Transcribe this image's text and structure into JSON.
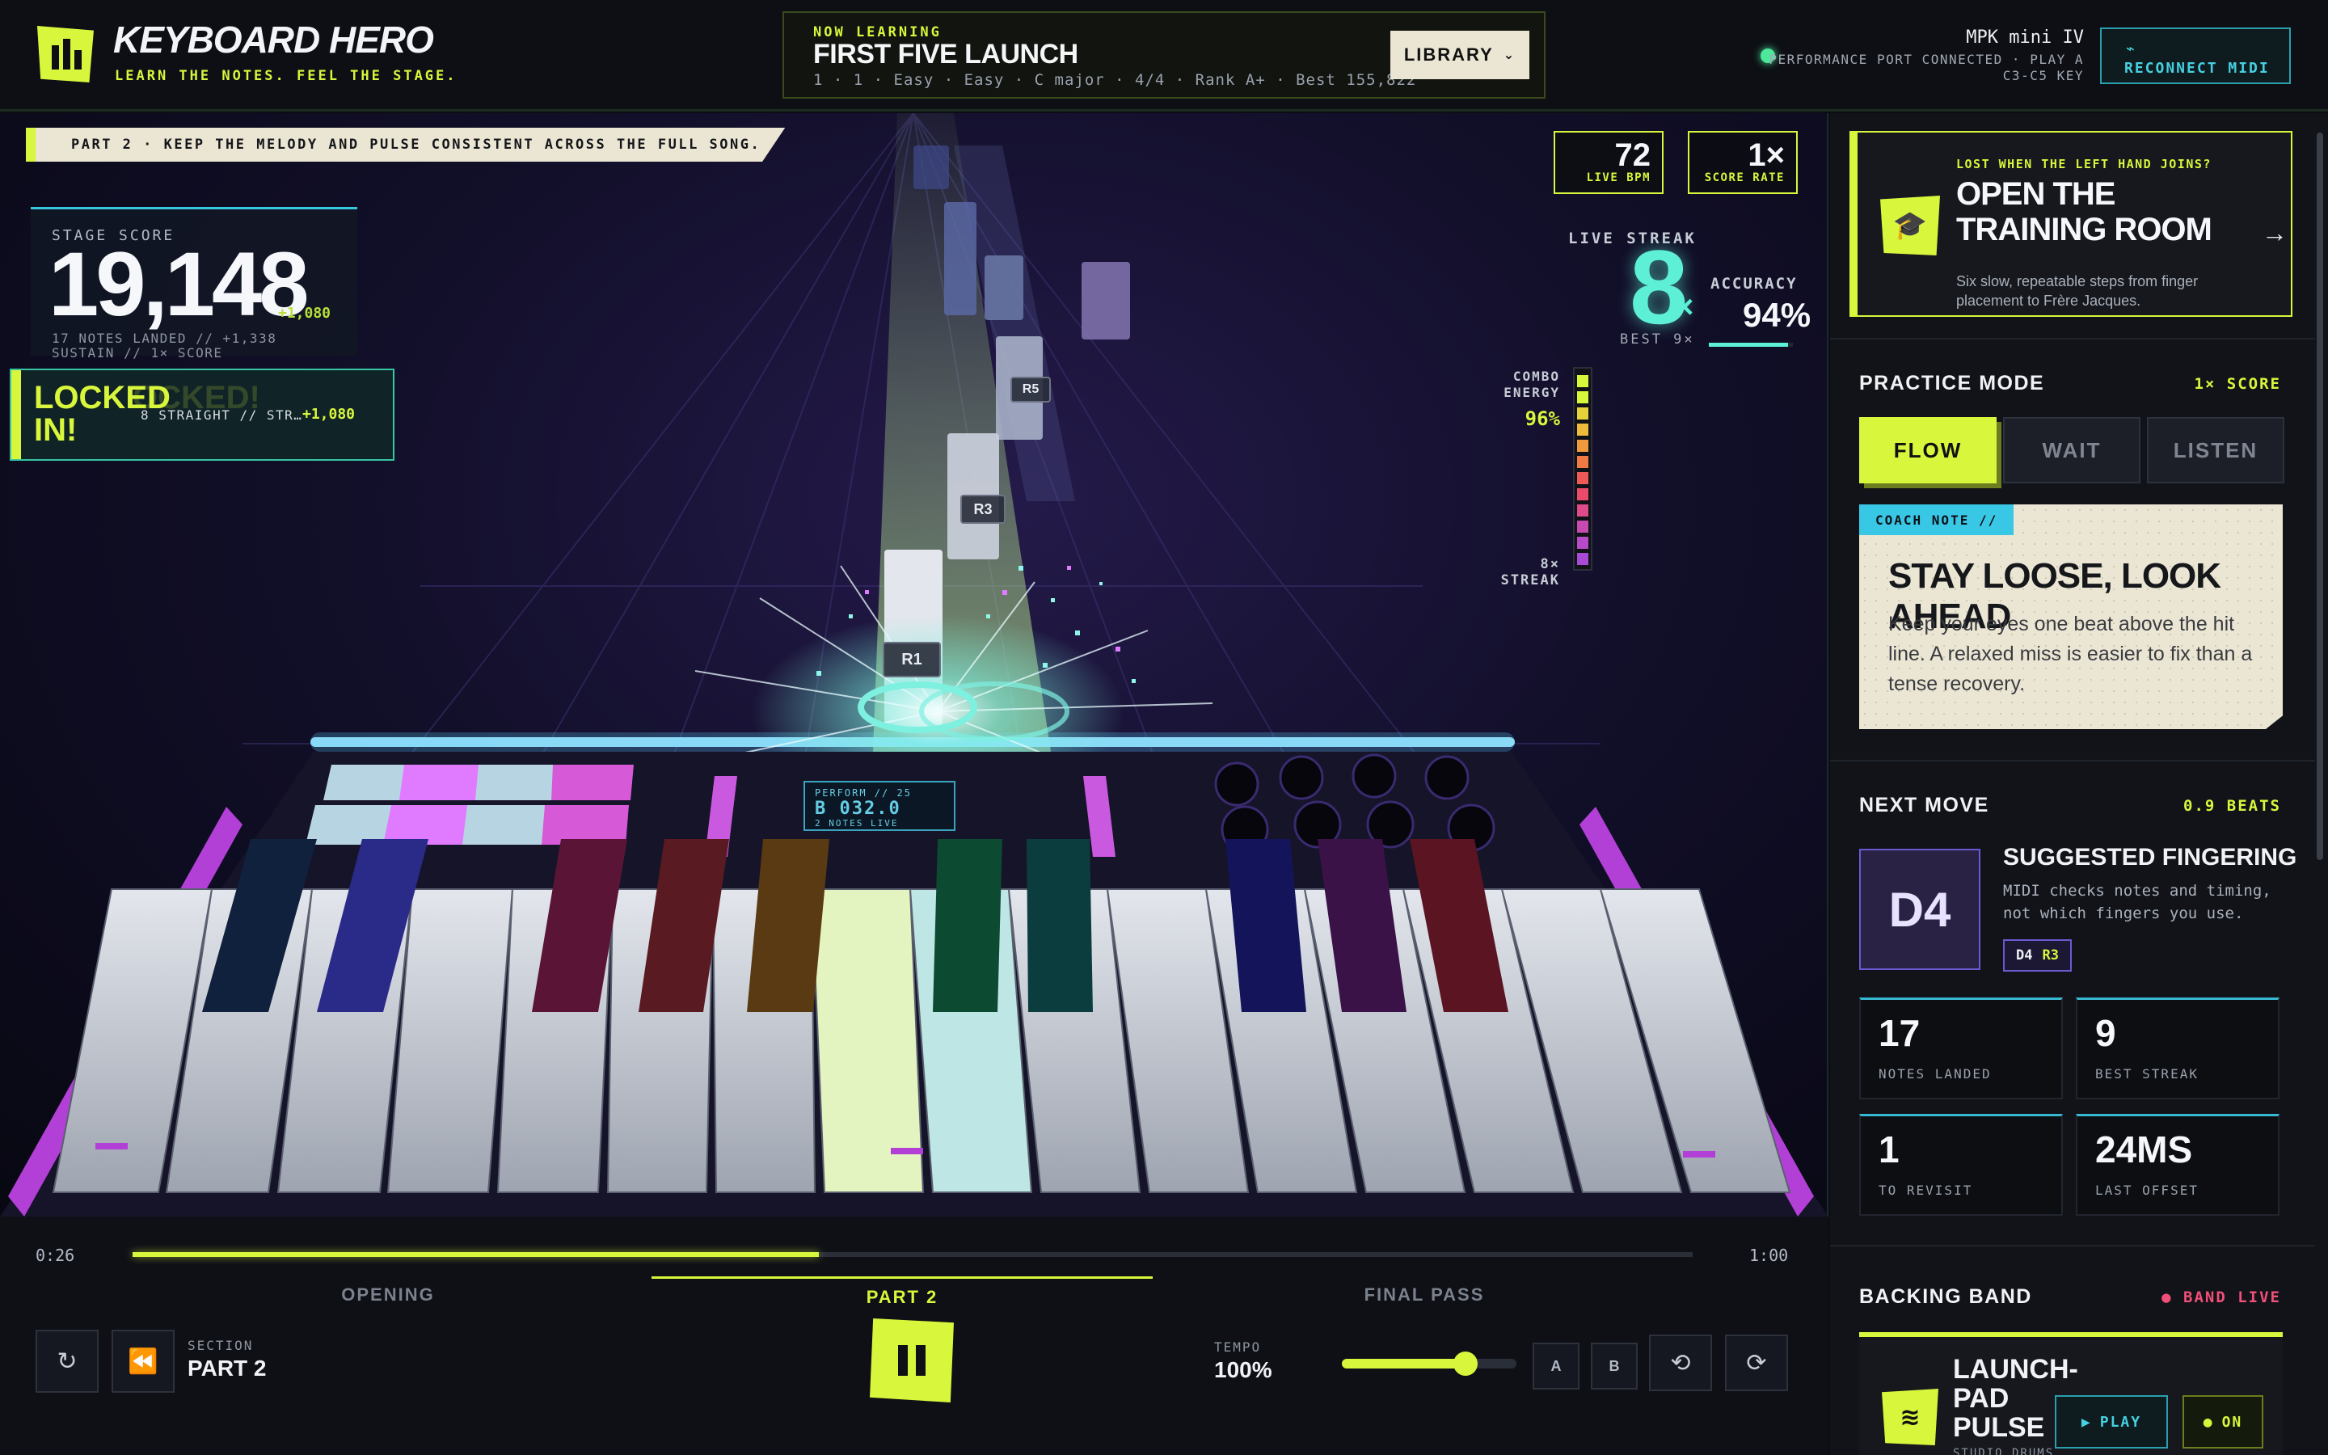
{
  "header": {
    "title": "KEYBOARD HERO",
    "tagline": "LEARN THE NOTES. FEEL THE STAGE.",
    "now_label": "NOW LEARNING",
    "now_title": "FIRST FIVE LAUNCH",
    "now_meta": "1 · 1 · Easy · Easy · C major · 4/4 · Rank A+ · Best 155,822",
    "library_label": "LIBRARY",
    "midi_name": "MPK mini IV",
    "midi_status": "PERFORMANCE PORT CONNECTED · PLAY A C3-C5 KEY",
    "reconnect_label": "RECONNECT MIDI"
  },
  "stage": {
    "banner": "PART 2 · KEEP THE MELODY AND PULSE CONSISTENT ACROSS THE FULL SONG.",
    "score_label": "STAGE SCORE",
    "score_value": "19,148",
    "score_delta": "+1,080",
    "score_sub1": "17 NOTES LANDED // +1,338",
    "score_sub2": "SUSTAIN // 1× SCORE",
    "locked_title": "LOCKED IN!",
    "locked_ghost": "OCKED!",
    "locked_detail": "8 STRAIGHT // STR…",
    "locked_points": "+1,080",
    "bpm_value": "72",
    "bpm_label": "LIVE BPM",
    "rate_value": "1×",
    "rate_label": "SCORE RATE",
    "streak_label": "LIVE STREAK",
    "streak_value": "8",
    "streak_x": "×",
    "streak_best": "BEST 9×",
    "accuracy_label": "ACCURACY",
    "accuracy_value": "94%",
    "accuracy_fraction": 0.94,
    "combo_label": "COMBO ENERGY",
    "combo_value": "96%",
    "combo_fraction": 0.96,
    "combo_streak": "8× STREAK",
    "note_r1": "R1",
    "note_r3": "R3",
    "note_r5": "R5",
    "perf_l1": "PERFORM // 25",
    "perf_l2": "B 032.0",
    "perf_l3": "2 NOTES LIVE"
  },
  "transport": {
    "time_start": "0:26",
    "time_end": "1:00",
    "progress_fraction": 0.44,
    "sections": [
      "OPENING",
      "PART 2",
      "FINAL PASS"
    ],
    "active_section": 1,
    "section_label": "SECTION",
    "section_name": "PART 2",
    "tempo_label": "TEMPO",
    "tempo_value": "100%",
    "tempo_fraction": 0.71,
    "loop_a": "A",
    "loop_b": "B"
  },
  "sidebar": {
    "training_kicker": "LOST WHEN THE LEFT HAND JOINS?",
    "training_title": "OPEN THE TRAINING ROOM",
    "training_desc": "Six slow, repeatable steps from finger placement to Frère Jacques.",
    "practice_title": "PRACTICE MODE",
    "practice_tag": "1× SCORE",
    "modes": [
      "FLOW",
      "WAIT",
      "LISTEN"
    ],
    "coach_tag": "COACH NOTE //",
    "coach_title": "STAY LOOSE, LOOK AHEAD",
    "coach_body": "Keep your eyes one beat above the hit line. A relaxed miss is easier to fix than a tense recovery.",
    "next_title": "NEXT MOVE",
    "next_tag": "0.9 BEATS",
    "next_note": "D4",
    "finger_title": "SUGGESTED FINGERING",
    "finger_desc": "MIDI checks notes and timing, not which fingers you use.",
    "finger_note": "D4",
    "finger_hand": "R3",
    "stats": [
      {
        "value": "17",
        "label": "NOTES LANDED"
      },
      {
        "value": "9",
        "label": "BEST STREAK"
      },
      {
        "value": "1",
        "label": "TO REVISIT"
      },
      {
        "value": "24MS",
        "label": "LAST OFFSET"
      }
    ],
    "band_title": "BACKING BAND",
    "band_live": "● BAND LIVE",
    "band_name": "LAUNCH-PAD PULSE",
    "band_sub": "STUDIO DRUMS",
    "band_play": "PLAY",
    "band_on": "ON"
  },
  "colors": {
    "accent": "#d8f63c",
    "cyan": "#37c6e0",
    "magenta": "#b23fd6",
    "band_live": "#ef4f78"
  }
}
